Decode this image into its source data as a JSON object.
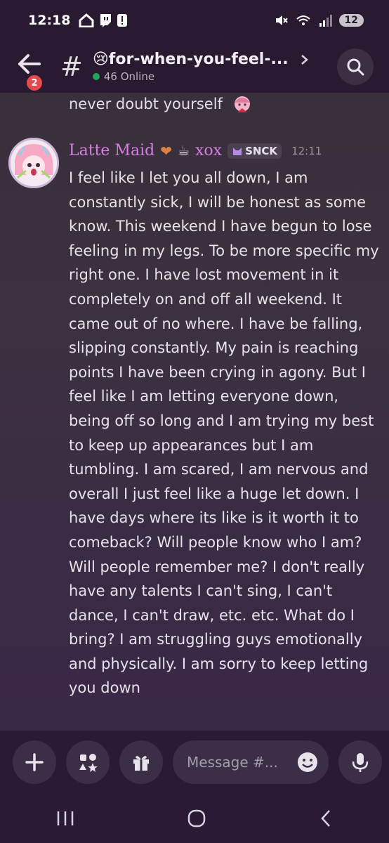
{
  "status_bar": {
    "time": "12:18",
    "battery": "12"
  },
  "header": {
    "back_badge": "2",
    "channel_emoji": "😢",
    "channel_name": "for-when-you-feel-...",
    "online_count": "46 Online"
  },
  "previous_message": {
    "text": "never doubt yourself"
  },
  "message": {
    "username": "Latte Maid",
    "username_suffix": "xox",
    "tag": "SNCK",
    "timestamp": "12:11",
    "body": "I feel like I let you all down, I am constantly sick, I will be honest as some know. This weekend I have begun to lose feeling in my legs. To be more specific my right one. I have lost movement in it completely on and off all weekend. It came out of no where. I have be falling, slipping constantly. My pain is reaching points I have been crying in agony. But I feel like I am letting everyone down, being off so long and I am trying my best to keep up appearances but I am tumbling. I am scared, I am nervous and overall I just feel like a huge let down. I have days where its like is it worth it to comeback? Will people know who I am? Will people remember me? I don't really have any talents I can't sing, I can't dance, I can't draw, etc. etc. What do I bring? I am struggling guys emotionally and physically. I am sorry to keep letting you down"
  },
  "composer": {
    "placeholder": "Message #..."
  },
  "colors": {
    "accent_username": "#d57ee2",
    "online_dot": "#23a55a",
    "badge_red": "#e5484d"
  },
  "icons": [
    "back-arrow-icon",
    "hash-icon",
    "search-icon",
    "plus-icon",
    "apps-icon",
    "gift-icon",
    "emoji-icon",
    "microphone-icon",
    "recents-icon",
    "home-icon",
    "back-icon"
  ]
}
